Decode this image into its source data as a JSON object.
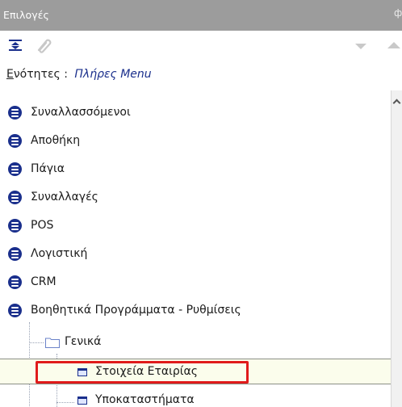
{
  "panel": {
    "title": "Επιλογές"
  },
  "toolbar": {
    "collapse_all_icon": "collapse-all-icon",
    "attachment_icon": "paperclip-icon",
    "move_down_icon": "triangle-down-icon",
    "move_up_icon": "triangle-up-icon"
  },
  "sections": {
    "label_first": "Ε",
    "label_rest": "νότητες :",
    "value": "Πλήρες Menu"
  },
  "tree": {
    "items": [
      {
        "label": "Συναλλασσόμενοι"
      },
      {
        "label": "Αποθήκη"
      },
      {
        "label": "Πάγια"
      },
      {
        "label": "Συναλλαγές"
      },
      {
        "label": "POS"
      },
      {
        "label": "Λογιστική"
      },
      {
        "label": "CRM"
      },
      {
        "label": "Βοηθητικά Προγράμματα - Ρυθμίσεις"
      }
    ],
    "folder": {
      "label": "Γενικά"
    },
    "children": [
      {
        "label": "Στοιχεία Εταιρίας",
        "selected": true
      },
      {
        "label": "Υποκαταστήματα"
      }
    ]
  },
  "colors": {
    "title_bar": "#9c9c9c",
    "menu_icon": "#1a2f8c",
    "highlight": "#e01b1b"
  }
}
